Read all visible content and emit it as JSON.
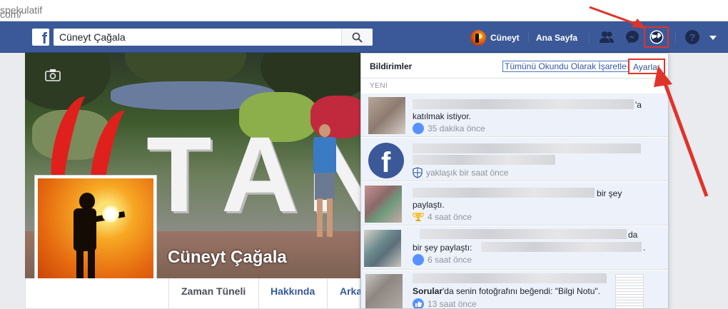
{
  "address_bar": {
    "prefix": "com/",
    "path": "spekulatif"
  },
  "topbar": {
    "logo": "f",
    "search_value": "Cüneyt Çağala",
    "user_name": "Cüneyt",
    "home_label": "Ana Sayfa",
    "icons": [
      "friends-icon",
      "messenger-icon",
      "notifications-globe-icon",
      "help-icon",
      "account-menu-caret-icon"
    ]
  },
  "profile": {
    "name": "Cüneyt Çağala",
    "tabs": [
      "Zaman Tüneli",
      "Hakkında",
      "Arka"
    ]
  },
  "notifications": {
    "title": "Bildirimler",
    "mark_all_read": "Tümünü Okundu Olarak İşaretle",
    "separator": "·",
    "settings": "Ayarlar",
    "section_new": "YENİ",
    "items": [
      {
        "text_pre": "",
        "text_line1_end": "'a",
        "text_line2": "katılmak istiyor.",
        "time": "35 dakika önce",
        "meta_icon": "group-icon"
      },
      {
        "text_line2": "",
        "time": "yaklaşık bir saat önce",
        "meta_icon": "shield-icon"
      },
      {
        "text_line1_end": "bir şey",
        "text_line2": "paylaştı.",
        "time": "4 saat önce",
        "meta_icon": "trophy-icon"
      },
      {
        "text_line1_end": "da",
        "text_line2": "bir şey paylaştı:",
        "text_line2_end": ".",
        "time": "6 saat önce",
        "meta_icon": "group-icon"
      },
      {
        "text_bold": "Sorular",
        "text_rest": "'da senin fotoğrafını beğendi: \"Bilgi Notu\".",
        "time": "13 saat önce",
        "meta_icon": "like-icon"
      }
    ]
  }
}
